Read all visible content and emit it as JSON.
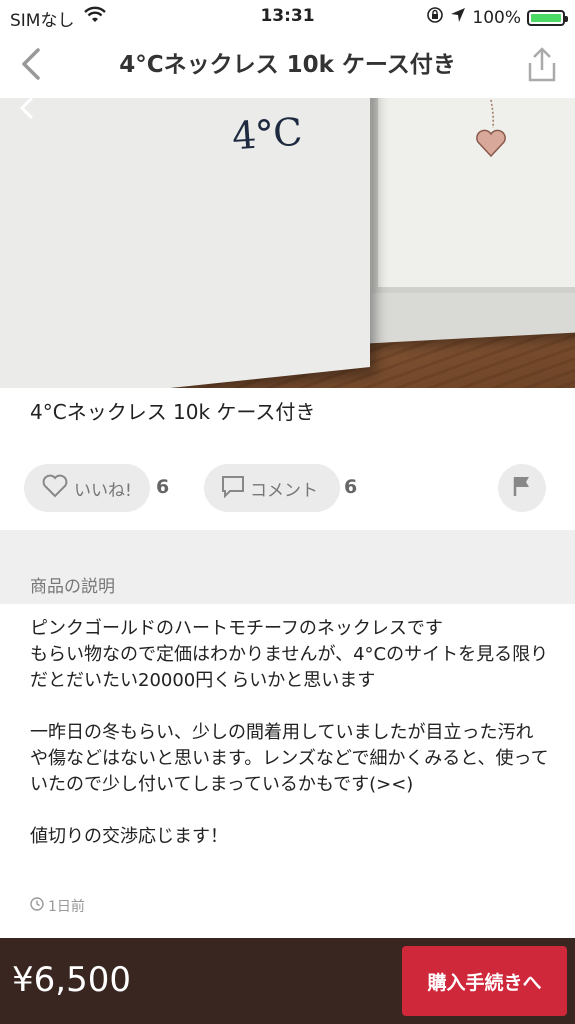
{
  "status_bar": {
    "carrier": "SIMなし",
    "time": "13:31",
    "battery": "100%"
  },
  "nav": {
    "title": "4°Cネックレス 10k ケース付き"
  },
  "photo": {
    "logo_text": "4°C"
  },
  "item": {
    "title": "4°Cネックレス 10k ケース付き"
  },
  "actions": {
    "like_label": "いいね!",
    "like_count": "6",
    "comment_label": "コメント",
    "comment_count": "6"
  },
  "description": {
    "section_title": "商品の説明",
    "paragraphs": [
      "ピンクゴールドのハートモチーフのネックレスです\nもらい物なので定価はわかりませんが、4°Cのサイトを見る限りだとだいたい20000円くらいかと思います",
      "一昨日の冬もらい、少しの間着用していましたが目立った汚れや傷などはないと思います。レンズなどで細かくみると、使っていたので少し付いてしまっているかもです(><)",
      "値切りの交渉応じます！"
    ],
    "posted": "1日前"
  },
  "footer": {
    "price": "¥6,500",
    "buy_label": "購入手続きへ"
  },
  "colors": {
    "accent": "#d0283b",
    "footer_bg": "#3a2621",
    "battery": "#4cd964"
  }
}
